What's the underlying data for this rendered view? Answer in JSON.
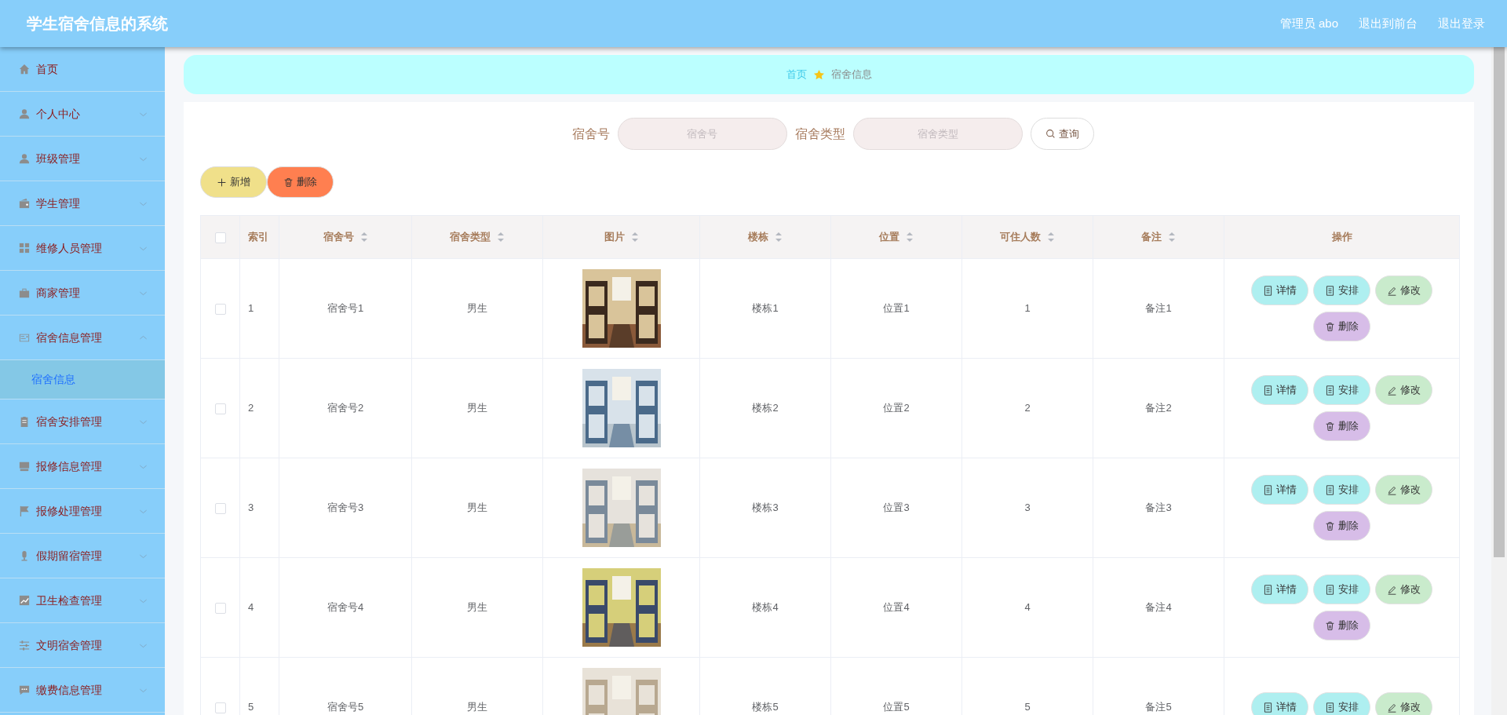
{
  "header": {
    "title": "学生宿舍信息的系统",
    "links": [
      "管理员 abo",
      "退出到前台",
      "退出登录"
    ]
  },
  "sidebar": {
    "items": [
      {
        "label": "首页",
        "kind": "link"
      },
      {
        "label": "个人中心",
        "kind": "menu",
        "expanded": false
      },
      {
        "label": "班级管理",
        "kind": "menu",
        "expanded": false
      },
      {
        "label": "学生管理",
        "kind": "menu",
        "expanded": false
      },
      {
        "label": "维修人员管理",
        "kind": "menu",
        "expanded": false
      },
      {
        "label": "商家管理",
        "kind": "menu",
        "expanded": false
      },
      {
        "label": "宿舍信息管理",
        "kind": "menu",
        "expanded": true,
        "children": [
          {
            "label": "宿舍信息",
            "selected": true
          }
        ]
      },
      {
        "label": "宿舍安排管理",
        "kind": "menu",
        "expanded": false
      },
      {
        "label": "报修信息管理",
        "kind": "menu",
        "expanded": false
      },
      {
        "label": "报修处理管理",
        "kind": "menu",
        "expanded": false
      },
      {
        "label": "假期留宿管理",
        "kind": "menu",
        "expanded": false
      },
      {
        "label": "卫生检查管理",
        "kind": "menu",
        "expanded": false
      },
      {
        "label": "文明宿舍管理",
        "kind": "menu",
        "expanded": false
      },
      {
        "label": "缴费信息管理",
        "kind": "menu",
        "expanded": false
      }
    ]
  },
  "breadcrumb": [
    "首页",
    "宿舍信息"
  ],
  "search": {
    "fields": [
      {
        "label": "宿舍号",
        "placeholder": "宿舍号"
      },
      {
        "label": "宿舍类型",
        "placeholder": "宿舍类型"
      }
    ],
    "button": "查询"
  },
  "toolbar": [
    {
      "label": "新增",
      "kind": "add"
    },
    {
      "label": "删除",
      "kind": "delete"
    }
  ],
  "table": {
    "columns": [
      {
        "label": "索引",
        "sortable": false
      },
      {
        "label": "宿舍号",
        "sortable": true
      },
      {
        "label": "宿舍类型",
        "sortable": true
      },
      {
        "label": "图片",
        "sortable": true
      },
      {
        "label": "楼栋",
        "sortable": true
      },
      {
        "label": "位置",
        "sortable": true
      },
      {
        "label": "可住人数",
        "sortable": true
      },
      {
        "label": "备注",
        "sortable": true
      },
      {
        "label": "操作",
        "sortable": false
      }
    ],
    "header_checked": false,
    "rows": [
      {
        "checked": false,
        "cells": [
          "1",
          "宿舍号1",
          "男生",
          {
            "kind": "picture"
          },
          "楼栋1",
          "位置1",
          "1",
          "备注1"
        ],
        "actions": [
          {
            "label": "详情",
            "kind": "detail"
          },
          {
            "label": "安排",
            "kind": "detail"
          },
          {
            "label": "修改",
            "kind": "edit"
          },
          {
            "label": "删除",
            "kind": "delete"
          }
        ]
      },
      {
        "checked": false,
        "cells": [
          "2",
          "宿舍号2",
          "男生",
          {
            "kind": "picture"
          },
          "楼栋2",
          "位置2",
          "2",
          "备注2"
        ],
        "actions": [
          {
            "label": "详情",
            "kind": "detail"
          },
          {
            "label": "安排",
            "kind": "detail"
          },
          {
            "label": "修改",
            "kind": "edit"
          },
          {
            "label": "删除",
            "kind": "delete"
          }
        ]
      },
      {
        "checked": false,
        "cells": [
          "3",
          "宿舍号3",
          "男生",
          {
            "kind": "picture"
          },
          "楼栋3",
          "位置3",
          "3",
          "备注3"
        ],
        "actions": [
          {
            "label": "详情",
            "kind": "detail"
          },
          {
            "label": "安排",
            "kind": "detail"
          },
          {
            "label": "修改",
            "kind": "edit"
          },
          {
            "label": "删除",
            "kind": "delete"
          }
        ]
      },
      {
        "checked": false,
        "cells": [
          "4",
          "宿舍号4",
          "男生",
          {
            "kind": "picture"
          },
          "楼栋4",
          "位置4",
          "4",
          "备注4"
        ],
        "actions": [
          {
            "label": "详情",
            "kind": "detail"
          },
          {
            "label": "安排",
            "kind": "detail"
          },
          {
            "label": "修改",
            "kind": "edit"
          },
          {
            "label": "删除",
            "kind": "delete"
          }
        ]
      },
      {
        "checked": false,
        "cells": [
          "5",
          "宿舍号5",
          "男生",
          {
            "kind": "picture"
          },
          "楼栋5",
          "位置5",
          "5",
          "备注5"
        ],
        "actions": [
          {
            "label": "详情",
            "kind": "detail"
          },
          {
            "label": "安排",
            "kind": "detail"
          },
          {
            "label": "修改",
            "kind": "edit"
          }
        ]
      }
    ]
  }
}
